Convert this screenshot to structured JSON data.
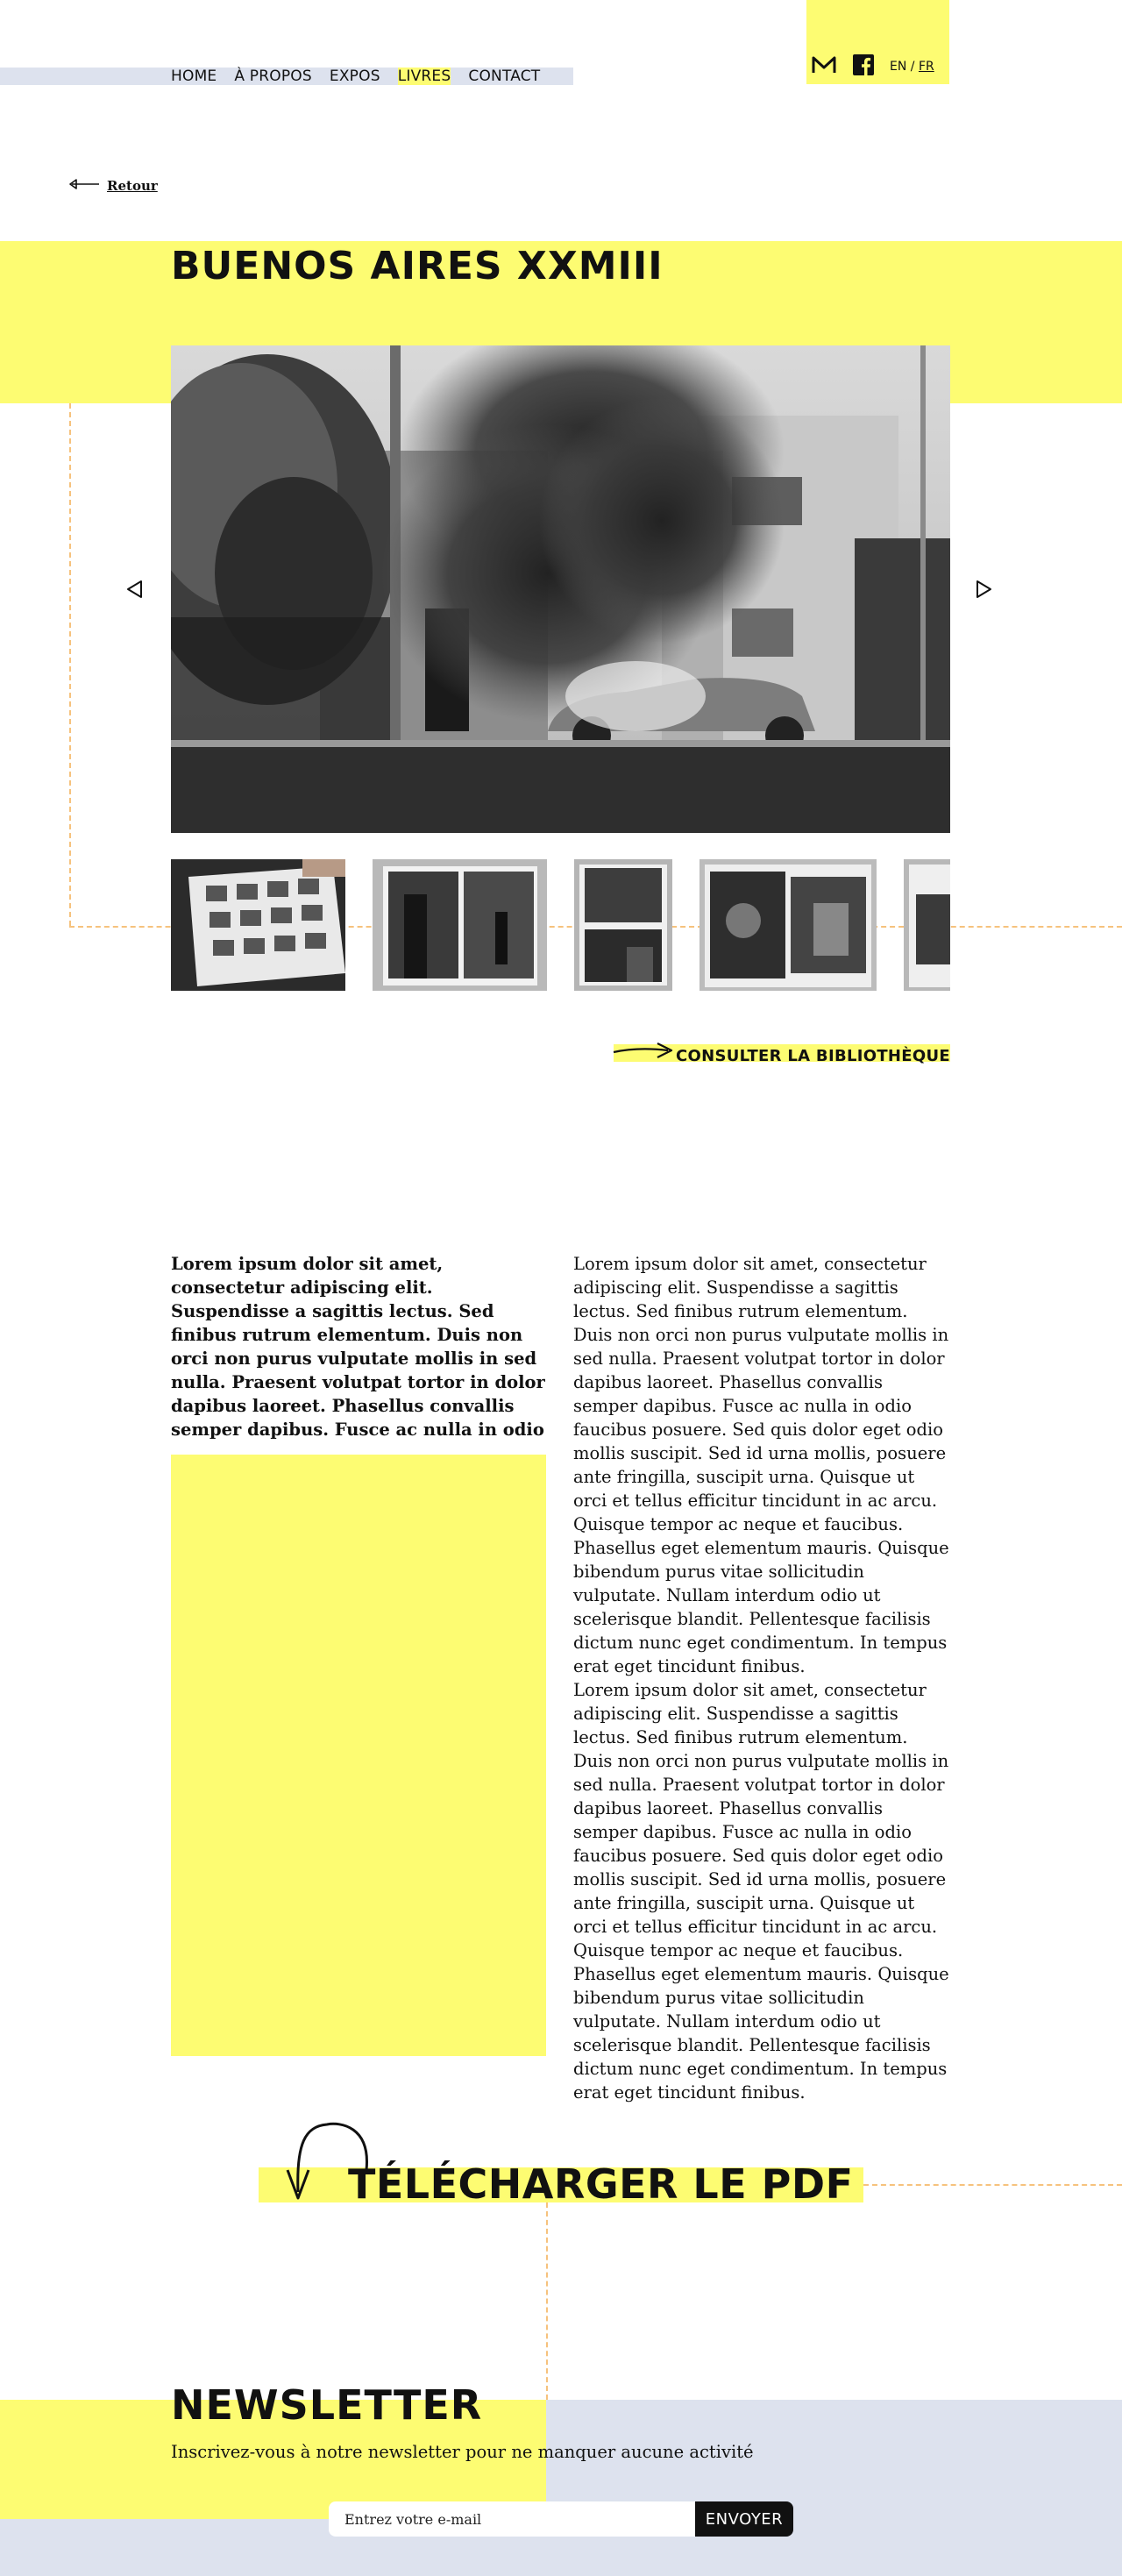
{
  "header": {
    "nav": [
      {
        "label": "HOME",
        "active": false
      },
      {
        "label": "À PROPOS",
        "active": false
      },
      {
        "label": "EXPOS",
        "active": false
      },
      {
        "label": "LIVRES",
        "active": true
      },
      {
        "label": "CONTACT",
        "active": false
      }
    ],
    "social": {
      "mail_icon": "mail-icon",
      "facebook_icon": "facebook-icon"
    },
    "lang": {
      "en": "EN",
      "separator": "/",
      "fr": "FR",
      "current": "FR"
    }
  },
  "back_link": {
    "label": "Retour",
    "icon": "arrow-left-icon"
  },
  "book": {
    "title": "BUENOS AIRES XXMIII",
    "hero_image": "street-with-burning-car-photo",
    "prev_icon": "triangle-left-icon",
    "next_icon": "triangle-right-icon",
    "thumbnails": [
      {
        "name": "thumb-contact-sheet"
      },
      {
        "name": "thumb-book-spread-buildings"
      },
      {
        "name": "thumb-book-page-landscape"
      },
      {
        "name": "thumb-book-spread-interior"
      },
      {
        "name": "thumb-book-spread-partial"
      }
    ]
  },
  "consult_link": {
    "label": "CONSULTER LA BIBLIOTHÈQUE",
    "icon": "arrow-right-icon"
  },
  "content": {
    "lead": "Lorem ipsum dolor sit amet, consectetur adipiscing elit. Suspendisse a sagittis lectus. Sed finibus rutrum elementum. Duis non orci non purus vulputate mollis in sed nulla. Praesent volutpat tortor in dolor dapibus laoreet. Phasellus convallis semper dapibus. Fusce ac nulla in odio",
    "paragraphs": [
      "Lorem ipsum dolor sit amet, consectetur adipiscing elit. Suspendisse a sagittis lectus. Sed finibus rutrum elementum. Duis non orci non purus vulputate mollis in sed nulla. Praesent volutpat tortor in dolor dapibus laoreet. Phasellus convallis semper dapibus. Fusce ac nulla in odio faucibus posuere. Sed quis dolor eget odio mollis suscipit. Sed id urna mollis, posuere ante fringilla, suscipit urna. Quisque ut orci et tellus efficitur tincidunt in ac arcu. Quisque tempor ac neque et faucibus. Phasellus eget elementum mauris. Quisque bibendum purus vitae sollicitudin vulputate. Nullam interdum odio ut scelerisque blandit. Pellentesque facilisis dictum nunc eget condimentum. In tempus erat eget tincidunt finibus.",
      "Lorem ipsum dolor sit amet, consectetur adipiscing elit. Suspendisse a sagittis lectus. Sed finibus rutrum elementum. Duis non orci non purus vulputate mollis in sed nulla. Praesent volutpat tortor in dolor dapibus laoreet. Phasellus convallis semper dapibus. Fusce ac nulla in odio faucibus posuere. Sed quis dolor eget odio mollis suscipit. Sed id urna mollis, posuere ante fringilla, suscipit urna. Quisque ut orci et tellus efficitur tincidunt in ac arcu. Quisque tempor ac neque et faucibus. Phasellus eget elementum mauris. Quisque bibendum purus vitae sollicitudin vulputate. Nullam interdum odio ut scelerisque blandit. Pellentesque facilisis dictum nunc eget condimentum. In tempus erat eget tincidunt finibus."
    ]
  },
  "download": {
    "label": "TÉLÉCHARGER LE PDF",
    "icon": "curved-arrow-down-icon"
  },
  "newsletter": {
    "title": "NEWSLETTER",
    "subtitle": "Inscrivez-vous à notre newsletter pour ne manquer aucune activité",
    "placeholder": "Entrez votre e-mail",
    "button": "ENVOYER"
  },
  "colors": {
    "accent_yellow": "#fdfc72",
    "soft_blue": "#dde2ee",
    "dash_orange": "#f6c27d",
    "text": "#111111"
  }
}
